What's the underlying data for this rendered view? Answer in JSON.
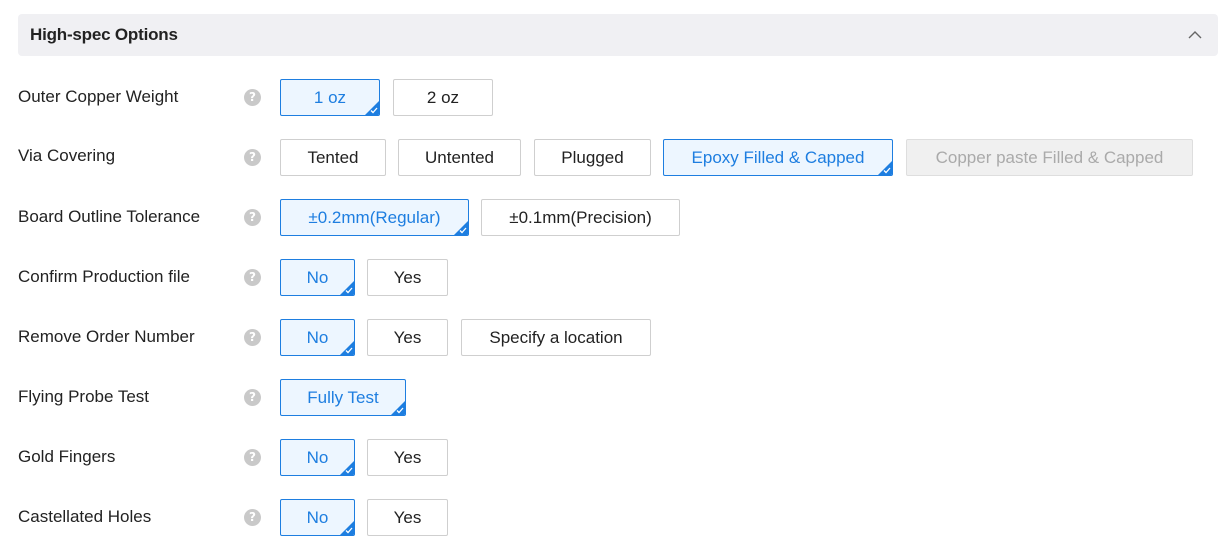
{
  "section": {
    "title": "High-spec Options"
  },
  "icons": {
    "collapse": "chevron-up-icon",
    "help": "question-mark-icon",
    "help_glyph": "?",
    "selected": "check-corner-icon"
  },
  "colors": {
    "accent": "#1e7ee0",
    "selected_bg": "#edf6ff",
    "disabled_bg": "#f0f0f0",
    "header_bg": "#f0f0f3"
  },
  "rows": [
    {
      "label": "Outer Copper Weight",
      "options": [
        {
          "label": "1 oz",
          "selected": true
        },
        {
          "label": "2 oz",
          "selected": false
        }
      ]
    },
    {
      "label": "Via Covering",
      "options": [
        {
          "label": "Tented",
          "selected": false
        },
        {
          "label": "Untented",
          "selected": false
        },
        {
          "label": "Plugged",
          "selected": false
        },
        {
          "label": "Epoxy Filled & Capped",
          "selected": true
        },
        {
          "label": "Copper paste Filled & Capped",
          "selected": false,
          "disabled": true
        }
      ]
    },
    {
      "label": "Board Outline Tolerance",
      "options": [
        {
          "label": "±0.2mm(Regular)",
          "selected": true
        },
        {
          "label": "±0.1mm(Precision)",
          "selected": false
        }
      ]
    },
    {
      "label": "Confirm Production file",
      "options": [
        {
          "label": "No",
          "selected": true
        },
        {
          "label": "Yes",
          "selected": false
        }
      ]
    },
    {
      "label": "Remove Order Number",
      "options": [
        {
          "label": "No",
          "selected": true
        },
        {
          "label": "Yes",
          "selected": false
        },
        {
          "label": "Specify a location",
          "selected": false
        }
      ]
    },
    {
      "label": "Flying Probe Test",
      "options": [
        {
          "label": "Fully Test",
          "selected": true
        }
      ]
    },
    {
      "label": "Gold Fingers",
      "options": [
        {
          "label": "No",
          "selected": true
        },
        {
          "label": "Yes",
          "selected": false
        }
      ]
    },
    {
      "label": "Castellated Holes",
      "options": [
        {
          "label": "No",
          "selected": true
        },
        {
          "label": "Yes",
          "selected": false
        }
      ]
    }
  ]
}
